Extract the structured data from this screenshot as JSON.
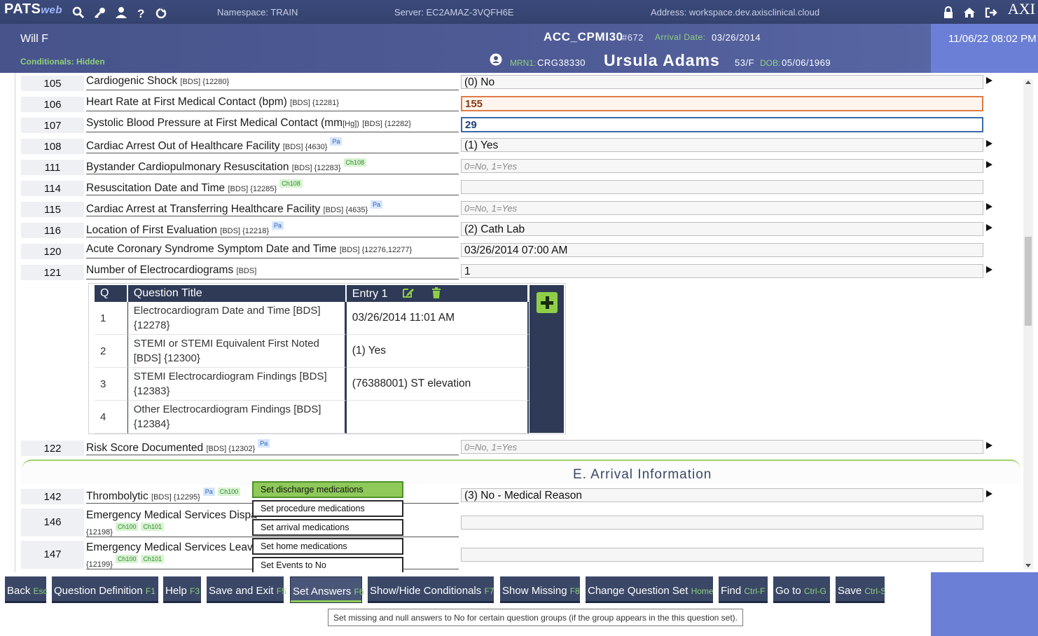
{
  "app": {
    "logo_main": "PATS",
    "logo_sub": "web",
    "brand": "AXI"
  },
  "topbar": {
    "namespace": "Namespace: TRAIN",
    "server": "Server: EC2AMAZ-3VQFH6E",
    "address": "Address: workspace.dev.axisclinical.cloud"
  },
  "header": {
    "user": "Will F",
    "conditionals": "Conditionals: Hidden",
    "form": "ACC_CPMI30",
    "form_num": "#672",
    "arrival_label": "Arrival Date:",
    "arrival_date": "03/26/2014",
    "mrn_label": "MRN1:",
    "mrn": "CRG38330",
    "patient_name": "Ursula Adams",
    "age_sex": "53/F",
    "dob_label": "DOB:",
    "dob": "05/06/1969",
    "datetime": "11/06/22 08:02 PM"
  },
  "rows": [
    {
      "num": "105",
      "title": "Cardiogenic Shock",
      "meta": "[BDS] {12280}",
      "badges": [],
      "answer": "(0) No",
      "answer_type": "normal",
      "arrow": true
    },
    {
      "num": "106",
      "title": "Heart Rate at First Medical Contact (bpm)",
      "meta": "[BDS] {12281}",
      "badges": [],
      "answer": "155",
      "answer_type": "err",
      "arrow": false
    },
    {
      "num": "107",
      "title": "Systolic Blood Pressure at First Medical Contact (mm",
      "title_sub": "[Hg])",
      "meta": "[BDS] {12282}",
      "badges": [],
      "answer": "29",
      "answer_type": "focus",
      "arrow": false
    },
    {
      "num": "108",
      "title": "Cardiac Arrest Out of Healthcare Facility",
      "meta": "[BDS] {4630}",
      "badges": [
        "Pa"
      ],
      "answer": "(1) Yes",
      "answer_type": "normal",
      "arrow": true
    },
    {
      "num": "111",
      "title": "Bystander Cardiopulmonary Resuscitation",
      "meta": "[BDS] {12283}",
      "badges": [
        "Ch108"
      ],
      "answer": "0=No, 1=Yes",
      "answer_type": "ph",
      "arrow": true
    },
    {
      "num": "114",
      "title": "Resuscitation Date and Time",
      "meta": "[BDS] {12285}",
      "badges": [
        "Ch108"
      ],
      "answer": "",
      "answer_type": "normal",
      "arrow": false
    },
    {
      "num": "115",
      "title": "Cardiac Arrest at Transferring Healthcare Facility",
      "meta": "[BDS] {4635}",
      "badges": [
        "Pa"
      ],
      "answer": "0=No, 1=Yes",
      "answer_type": "ph",
      "arrow": true
    },
    {
      "num": "116",
      "title": "Location of First Evaluation",
      "meta": "[BDS] {12218}",
      "badges": [
        "Pa"
      ],
      "answer": "(2) Cath Lab",
      "answer_type": "normal",
      "arrow": true
    },
    {
      "num": "120",
      "title": "Acute Coronary Syndrome Symptom Date and Time",
      "meta": "[BDS] {12276,12277}",
      "badges": [],
      "answer": "03/26/2014 07:00 AM",
      "answer_type": "normal",
      "arrow": false
    },
    {
      "num": "121",
      "title": "Number of Electrocardiograms",
      "meta": "[BDS]",
      "badges": [],
      "answer": "1",
      "answer_type": "normal",
      "arrow": true
    }
  ],
  "subgrid": {
    "headers": {
      "q": "Q",
      "title": "Question Title",
      "entry": "Entry 1"
    },
    "rows": [
      {
        "q": "1",
        "title": "Electrocardiogram Date and Time [BDS] {12278}",
        "value": "03/26/2014 11:01 AM"
      },
      {
        "q": "2",
        "title": "STEMI or STEMI Equivalent First Noted [BDS] {12300}",
        "value": "(1) Yes"
      },
      {
        "q": "3",
        "title": "STEMI Electrocardiogram Findings [BDS] {12383}",
        "value": "(76388001) ST elevation"
      },
      {
        "q": "4",
        "title": "Other Electrocardiogram Findings [BDS] {12384}",
        "value": ""
      }
    ]
  },
  "row122": {
    "num": "122",
    "title": "Risk Score Documented",
    "meta": "[BDS] {12302}",
    "badge": "Pa",
    "answer": "0=No, 1=Yes"
  },
  "section_title": "E. Arrival Information",
  "rows_after": [
    {
      "num": "142",
      "title": "Thrombolytic",
      "meta": "[BDS] {12295}",
      "badges": [
        "Pa",
        "Ch100"
      ],
      "answer": "(3) No - Medical Reason"
    },
    {
      "num": "146",
      "title": "Emergency Medical Services Dispa",
      "meta2": "{12198}",
      "badges": [
        "Ch100",
        "Ch101"
      ],
      "answer": ""
    },
    {
      "num": "147",
      "title": "Emergency Medical Services Leavi",
      "meta2": "{12199}",
      "badges": [
        "Ch100",
        "Ch101"
      ],
      "answer": ""
    }
  ],
  "popup_menu": [
    {
      "label": "Set discharge medications",
      "highlight": true
    },
    {
      "label": "Set procedure medications",
      "highlight": false
    },
    {
      "label": "Set arrival medications",
      "highlight": false
    },
    {
      "label": "Set home medications",
      "highlight": false
    },
    {
      "label": "Set Events to No",
      "highlight": false
    }
  ],
  "buttons": [
    {
      "label": "Back",
      "key": "Esc"
    },
    {
      "label": "Question Definition",
      "key": "F1"
    },
    {
      "label": "Help",
      "key": "F3"
    },
    {
      "label": "Save and Exit",
      "key": "F5"
    },
    {
      "label": "Set Answers",
      "key": "F6"
    },
    {
      "label": "Show/Hide Conditionals",
      "key": "F7"
    },
    {
      "label": "Show Missing",
      "key": "F8"
    },
    {
      "label": "Change Question Set",
      "key": "Home"
    },
    {
      "label": "Find",
      "key": "Ctrl-F"
    },
    {
      "label": "Go to",
      "key": "Ctrl-G"
    },
    {
      "label": "Save",
      "key": "Ctrl-S"
    }
  ],
  "tooltip": "Set missing and null answers to No for certain question groups (if the group appears in the this question set).",
  "icons": [
    "search-icon",
    "key-icon",
    "user-icon",
    "help-icon",
    "power-icon",
    "lock-icon",
    "home-icon",
    "logout-icon",
    "patient-icon",
    "edit-icon",
    "trash-icon",
    "add-icon"
  ],
  "colors": {
    "accent_green": "#8ec95a",
    "header": "#47538a",
    "button": "#3a4766",
    "date_box": "#6b7fd6"
  }
}
